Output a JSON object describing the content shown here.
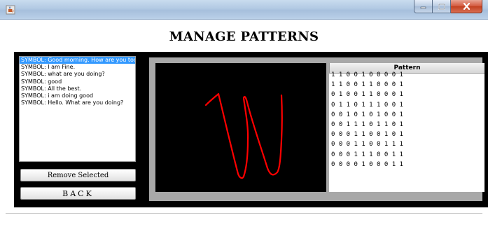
{
  "window": {
    "title": "",
    "buttons": [
      "minimize",
      "maximize",
      "close"
    ]
  },
  "page_title": "MANAGE PATTERNS",
  "symbols": [
    "SYMBOL: Good morning. How are you today?",
    "SYMBOL: I am Fine.",
    "SYMBOL: what are you doing?",
    "SYMBOL: good",
    "SYMBOL: All the best.",
    "SYMBOL: i am doing good",
    "SYMBOL: Hello. What are you doing?"
  ],
  "selected_index": 0,
  "buttons": {
    "remove": "Remove Selected",
    "back": "BACK"
  },
  "pattern_table": {
    "header": "Pattern",
    "rows": [
      "1 1 0 0 1 0 0 0 0 1",
      "1 1 0 0 1 1 0 0 0 1",
      "0 1 0 0 1 1 0 0 0 1",
      "0 1 1 0 1 1 1 0 0 1",
      "0 0 1 0 1 0 1 0 0 1",
      "0 0 1 1 1 0 1 1 0 1",
      "0 0 0 1 1 0 0 1 0 1",
      "0 0 0 1 1 0 0 1 1 1",
      "0 0 0 1 1 1 0 0 1 1",
      "0 0 0 0 1 0 0 0 1 1"
    ]
  },
  "colors": {
    "selection": "#3399ff",
    "stroke": "#ff0000",
    "canvas_bg": "#000000",
    "panel_bg": "#a8a8a8"
  },
  "icons": [
    "java-cup-icon",
    "minimize-icon",
    "maximize-icon",
    "close-icon"
  ]
}
